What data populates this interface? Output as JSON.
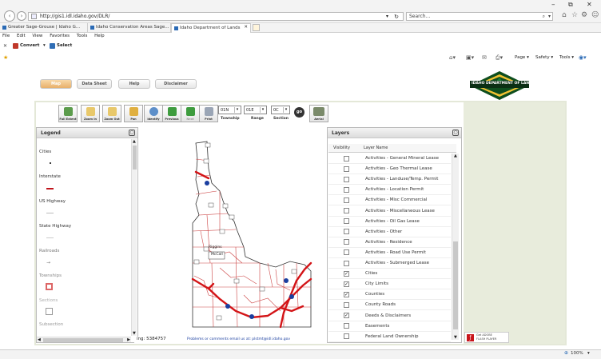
{
  "browser": {
    "url": "http://gis1.idl.idaho.gov/DLR/",
    "search_placeholder": "Search...",
    "tabs": [
      {
        "label": "Greater Sage-Grouse | Idaho G..."
      },
      {
        "label": "Idaho Conservation Areas Sage..."
      },
      {
        "label": "Idaho Department of Lands"
      }
    ],
    "menu": [
      "File",
      "Edit",
      "View",
      "Favorites",
      "Tools",
      "Help"
    ],
    "convert_label": "Convert",
    "select_label": "Select",
    "cmd_items": [
      "Page ▾",
      "Safety ▾",
      "Tools ▾"
    ],
    "zoom": "100%"
  },
  "app": {
    "tabs": [
      "Map",
      "Data Sheet",
      "Help",
      "Disclaimer"
    ],
    "logo_text": "IDAHO DEPARTMENT OF LANDS",
    "toolbar": {
      "buttons": [
        "Full Extent",
        "Zoom In",
        "Zoom Out",
        "Pan",
        "Identify",
        "Previous",
        "Next",
        "Print",
        "Aerial"
      ],
      "township_value": "01N",
      "range_value": "01E",
      "section_value": "0C",
      "township_label": "Township",
      "range_label": "Range",
      "section_label": "Section",
      "go_label": "go"
    },
    "legend": {
      "title": "Legend",
      "items": [
        "Cities",
        "Interstate",
        "US Highway",
        "State Highway",
        "Railroads",
        "Townships",
        "Sections",
        "Subsection"
      ]
    },
    "layers": {
      "title": "Layers",
      "col_visibility": "Visibility",
      "col_name": "Layer Name",
      "rows": [
        {
          "name": "Activities - General Mineral Lease",
          "checked": false
        },
        {
          "name": "Activities - Geo Thermal Lease",
          "checked": false
        },
        {
          "name": "Activities - Landuse/Temp. Permit",
          "checked": false
        },
        {
          "name": "Activities - Location Permit",
          "checked": false
        },
        {
          "name": "Activities - Misc Commercial",
          "checked": false
        },
        {
          "name": "Activities - Miscellaneous Lease",
          "checked": false
        },
        {
          "name": "Activities - Oil Gas Lease",
          "checked": false
        },
        {
          "name": "Activities - Other",
          "checked": false
        },
        {
          "name": "Activities - Residence",
          "checked": false
        },
        {
          "name": "Activities - Road Use Permit",
          "checked": false
        },
        {
          "name": "Activities - Submerged Lease",
          "checked": false
        },
        {
          "name": "Cities",
          "checked": true
        },
        {
          "name": "City Limits",
          "checked": true
        },
        {
          "name": "Counties",
          "checked": true
        },
        {
          "name": "County Roads",
          "checked": false
        },
        {
          "name": "Deeds & Disclaimers",
          "checked": true
        },
        {
          "name": "Easements",
          "checked": false
        },
        {
          "name": "Federal Land Ownership",
          "checked": false
        }
      ]
    },
    "map": {
      "scale_text": "ing: 5384757",
      "contact_text": "Problems or comments email us at: plstmt@idl.idaho.gov",
      "labels": [
        "McCall",
        "Riggins"
      ]
    },
    "flash": {
      "label1": "Get ADOBE",
      "label2": "FLASH PLAYER"
    }
  }
}
